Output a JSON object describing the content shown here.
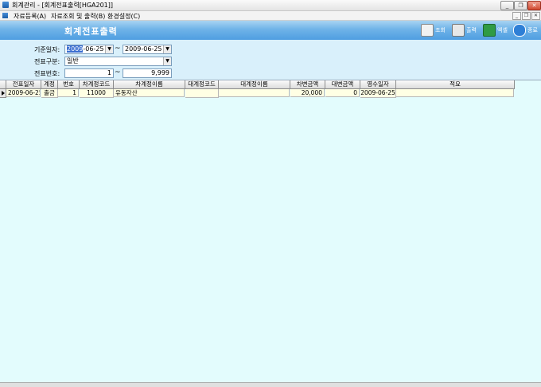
{
  "window": {
    "title": "회계관리 - [회계전표출력[HGA201]]",
    "minimize": "_",
    "restore": "❐",
    "close": "✕"
  },
  "menu": {
    "items": [
      "자료등록(A)",
      "자료조회 및 출력(B)",
      "환경설정(C)"
    ],
    "mdi_min": "_",
    "mdi_restore": "❐",
    "mdi_close": "✕"
  },
  "header": {
    "form_title": "회계전표출력",
    "buttons": [
      {
        "label": "조회",
        "icon": "search-doc-icon",
        "color": "#f2f2f2"
      },
      {
        "label": "출력",
        "icon": "printer-icon",
        "color": "#e8e8e8"
      },
      {
        "label": "엑셀",
        "icon": "excel-icon",
        "color": "#2f9b45"
      },
      {
        "label": "종료",
        "icon": "power-icon",
        "color": "#2e7fd6"
      }
    ]
  },
  "filters": {
    "date_label": "기준일자:",
    "date_from_hl": "2009",
    "date_from_rest": "-06-25",
    "date_to": "2009-06-25",
    "type_label": "전표구분:",
    "type_value": "일반",
    "number_label": "전표번호:",
    "number_from": "1",
    "number_to": "9,999",
    "tilde": "~",
    "dropdown_glyph": "▼"
  },
  "grid": {
    "columns": [
      "전표일자",
      "계정",
      "번호",
      "차계정코드",
      "차계정이름",
      "대계정코드",
      "대계정이름",
      "차변금액",
      "대변금액",
      "영수일자",
      "적요"
    ],
    "rows": [
      [
        "2009-06-25",
        "출금",
        "1",
        "11000",
        "유동자산",
        "",
        "",
        "20,000",
        "0",
        "2009-06-25",
        ""
      ]
    ]
  },
  "colors": {
    "header_blue": "#4f9ee1",
    "filter_bg": "#d9f0fb",
    "grid_bg": "#e3fcfd",
    "row_bg": "#ffffe4"
  }
}
